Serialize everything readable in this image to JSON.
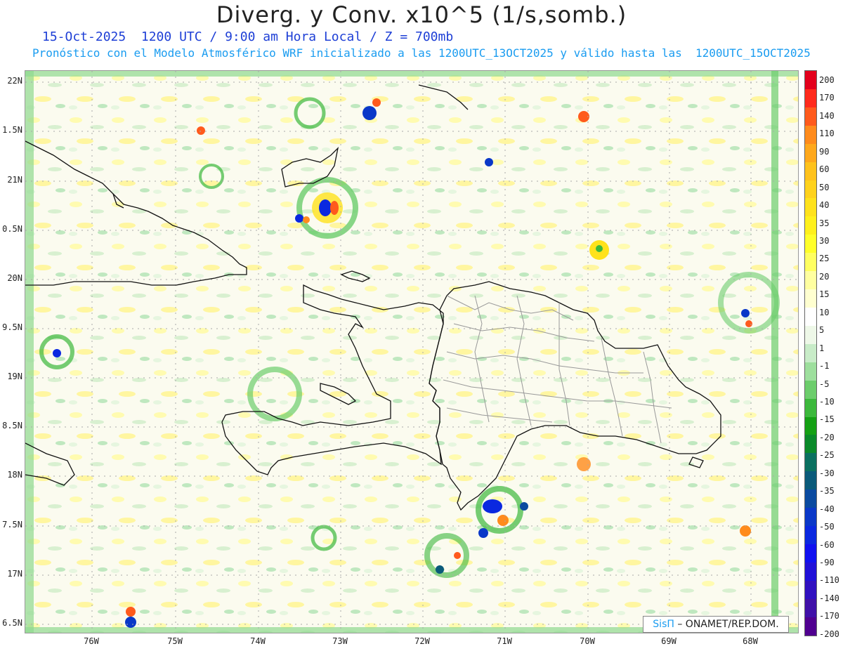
{
  "header": {
    "title": "Diverg. y Conv. x10^5 (1/s,somb.)",
    "line1": "15-Oct-2025  1200 UTC / 9:00 am Hora Local / Z = 700mb",
    "line2": "Pronóstico con el Modelo Atmosférico WRF inicializado a las 1200UTC_13OCT2025 y válido hasta las  1200UTC_15OCT2025"
  },
  "axes": {
    "lat_labels": [
      "22N",
      "1.5N",
      "21N",
      "0.5N",
      "20N",
      "9.5N",
      "19N",
      "8.5N",
      "18N",
      "7.5N",
      "17N",
      "6.5N"
    ],
    "lon_labels": [
      "76W",
      "75W",
      "74W",
      "73W",
      "72W",
      "71W",
      "70W",
      "69W",
      "68W"
    ]
  },
  "colorbar": {
    "labels": [
      "200",
      "170",
      "140",
      "110",
      "90",
      "60",
      "50",
      "40",
      "35",
      "30",
      "25",
      "20",
      "15",
      "10",
      "5",
      "1",
      "-1",
      "-5",
      "-10",
      "-15",
      "-20",
      "-25",
      "-30",
      "-35",
      "-40",
      "-50",
      "-60",
      "-90",
      "-110",
      "-140",
      "-170",
      "-200"
    ],
    "colors": [
      "#e3001c",
      "#ff2a1c",
      "#ff5a1c",
      "#ff8b1c",
      "#ffa81c",
      "#ffc21c",
      "#ffd21c",
      "#ffe21c",
      "#fff01c",
      "#ffff2a",
      "#ffff60",
      "#ffffa0",
      "#ffffd0",
      "#ffffff",
      "#eef8e8",
      "#c8ecc8",
      "#9ddf9d",
      "#6ccd6c",
      "#3cb83c",
      "#14a014",
      "#0a8a2a",
      "#0a7060",
      "#0a5a7a",
      "#0a4aa0",
      "#0a38c8",
      "#0a28e0",
      "#1010f0",
      "#2010d8",
      "#3010c0",
      "#4010a8",
      "#500090"
    ]
  },
  "credit": {
    "logo": "SisΠ",
    "text": "– ONAMET/REP.DOM."
  }
}
